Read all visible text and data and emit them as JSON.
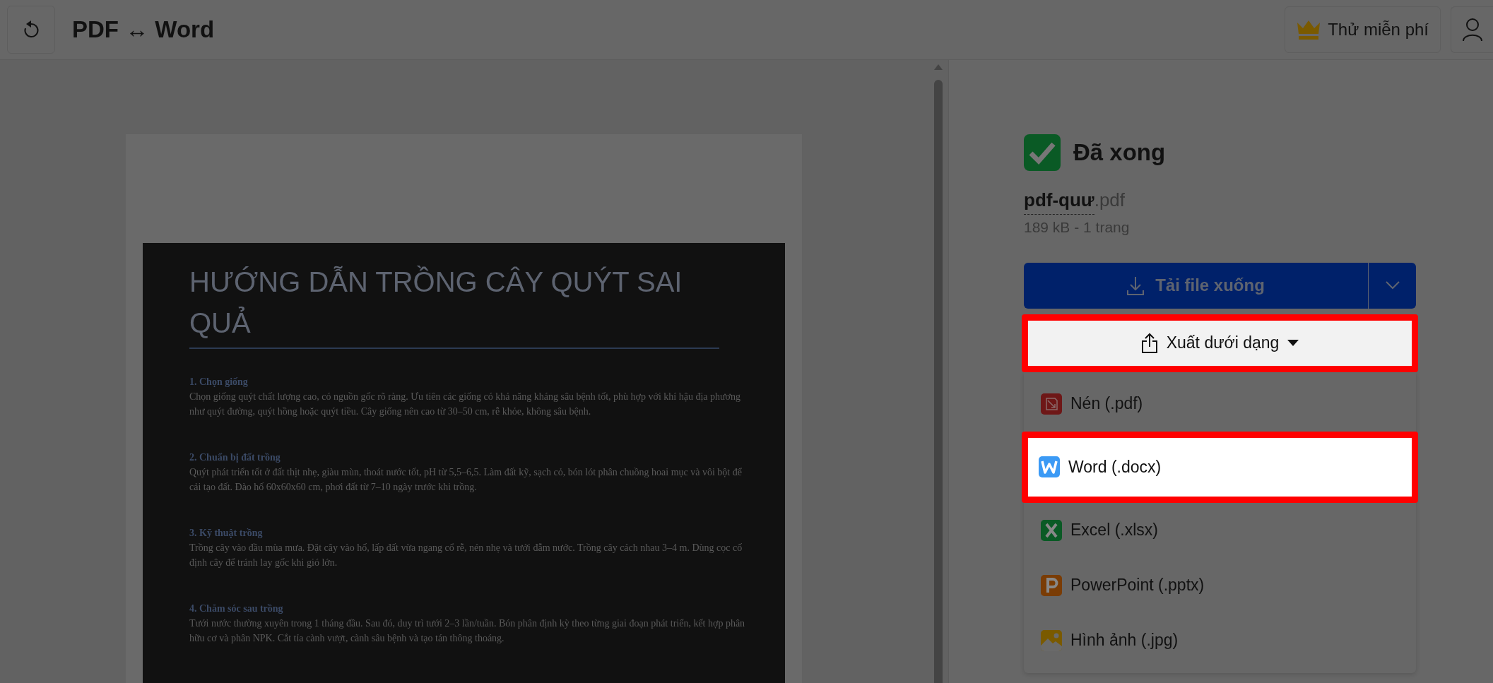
{
  "header": {
    "title": "PDF ↔ Word",
    "trial_button": "Thử miễn phí"
  },
  "document": {
    "title": "HƯỚNG DẪN TRỒNG CÂY QUÝT SAI QUẢ",
    "sections": [
      {
        "heading": "1. Chọn giống",
        "body": "Chọn giống quýt chất lượng cao, có nguồn gốc rõ ràng. Ưu tiên các giống có khả năng kháng sâu bệnh tốt, phù hợp với khí hậu địa phương như quýt đường, quýt hồng hoặc quýt tiều. Cây giống nên cao từ 30–50 cm, rễ khỏe, không sâu bệnh."
      },
      {
        "heading": "2. Chuẩn bị đất trồng",
        "body": "Quýt phát triển tốt ở đất thịt nhẹ, giàu mùn, thoát nước tốt, pH từ 5,5–6,5. Làm đất kỹ, sạch cỏ, bón lót phân chuồng hoai mục và vôi bột để cải tạo đất. Đào hố 60x60x60 cm, phơi đất từ 7–10 ngày trước khi trồng."
      },
      {
        "heading": "3. Kỹ thuật trồng",
        "body": "Trồng cây vào đầu mùa mưa. Đặt cây vào hố, lấp đất vừa ngang cổ rễ, nén nhẹ và tưới đẫm nước. Trồng cây cách nhau 3–4 m. Dùng cọc cố định cây để tránh lay gốc khi gió lớn."
      },
      {
        "heading": "4. Chăm sóc sau trồng",
        "body": "Tưới nước thường xuyên trong 1 tháng đầu. Sau đó, duy trì tưới 2–3 lần/tuần. Bón phân định kỳ theo từng giai đoạn phát triển, kết hợp phân hữu cơ và phân NPK. Cắt tỉa cành vượt, cành sâu bệnh và tạo tán thông thoáng."
      }
    ]
  },
  "result": {
    "status": "Đã xong",
    "file_name": "pdf-quư",
    "file_ext": ".pdf",
    "file_info": "189 kB - 1 trang",
    "download_button": "Tải file xuống",
    "export_button": {
      "label": "Xuất dưới dạng",
      "highlighted": true
    },
    "export_menu": [
      {
        "kind": "compress",
        "label": "Nén (.pdf)",
        "highlighted": false
      },
      {
        "kind": "word",
        "label": "Word (.docx)",
        "highlighted": true
      },
      {
        "kind": "excel",
        "label": "Excel (.xlsx)",
        "highlighted": false
      },
      {
        "kind": "powerpoint",
        "label": "PowerPoint (.pptx)",
        "highlighted": false
      },
      {
        "kind": "image",
        "label": "Hình ảnh (.jpg)",
        "highlighted": false
      }
    ]
  }
}
